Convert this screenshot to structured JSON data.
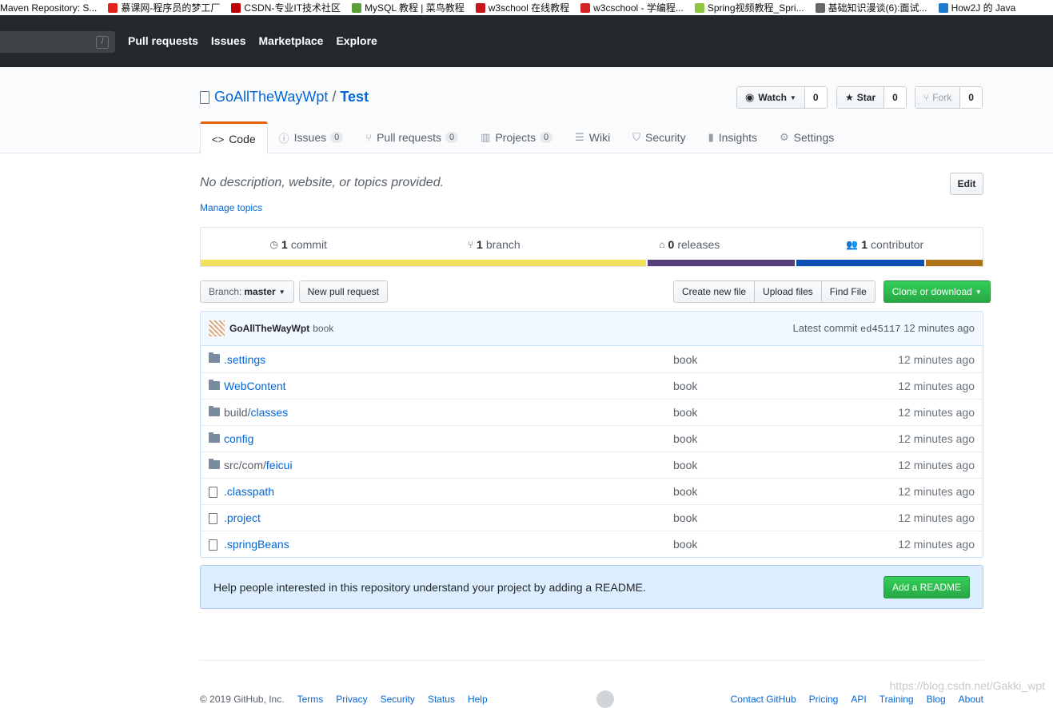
{
  "bookmarks": [
    {
      "label": "Maven Repository: S...",
      "color": "#ffffff"
    },
    {
      "label": "慕课网-程序员的梦工厂",
      "color": "#e2231a"
    },
    {
      "label": "CSDN-专业IT技术社区",
      "color": "#c00000"
    },
    {
      "label": "MySQL 教程 | 菜鸟教程",
      "color": "#5a9f35"
    },
    {
      "label": "w3school 在线教程",
      "color": "#c7161e"
    },
    {
      "label": "w3cschool - 学编程...",
      "color": "#d42322"
    },
    {
      "label": "Spring视频教程_Spri...",
      "color": "#8cc63e"
    },
    {
      "label": "基础知识漫谈(6):面试...",
      "color": "#666666"
    },
    {
      "label": "How2J 的 Java",
      "color": "#1e7bd0"
    }
  ],
  "header": {
    "search_slash": "/",
    "nav": [
      "Pull requests",
      "Issues",
      "Marketplace",
      "Explore"
    ]
  },
  "repo": {
    "owner": "GoAllTheWayWpt",
    "separator": "/",
    "name": "Test",
    "watch_label": "Watch",
    "watch_count": "0",
    "star_label": "Star",
    "star_count": "0",
    "fork_label": "Fork",
    "fork_count": "0"
  },
  "tabs": [
    {
      "label": "Code",
      "icon": "code-icon",
      "glyph": "<>",
      "counter": ""
    },
    {
      "label": "Issues",
      "icon": "issue-icon",
      "glyph": "ⓘ",
      "counter": "0"
    },
    {
      "label": "Pull requests",
      "icon": "pull-request-icon",
      "glyph": "⑂",
      "counter": "0"
    },
    {
      "label": "Projects",
      "icon": "project-icon",
      "glyph": "▥",
      "counter": "0"
    },
    {
      "label": "Wiki",
      "icon": "book-icon",
      "glyph": "☰",
      "counter": ""
    },
    {
      "label": "Security",
      "icon": "shield-icon",
      "glyph": "⛉",
      "counter": ""
    },
    {
      "label": "Insights",
      "icon": "graph-icon",
      "glyph": "▮",
      "counter": ""
    },
    {
      "label": "Settings",
      "icon": "gear-icon",
      "glyph": "⚙",
      "counter": ""
    }
  ],
  "description": {
    "text": "No description, website, or topics provided.",
    "manage_topics": "Manage topics",
    "edit_label": "Edit"
  },
  "summary": [
    {
      "count": "1",
      "label": "commit",
      "icon": "history-icon",
      "glyph": "◷"
    },
    {
      "count": "1",
      "label": "branch",
      "icon": "branch-icon",
      "glyph": "⑂"
    },
    {
      "count": "0",
      "label": "releases",
      "icon": "tag-icon",
      "glyph": "⌂"
    },
    {
      "count": "1",
      "label": "contributor",
      "icon": "people-icon",
      "glyph": "👥"
    }
  ],
  "languages": [
    {
      "color": "#f1e05a",
      "percent": 57.3
    },
    {
      "color": "#563d7c",
      "percent": 18.9
    },
    {
      "color": "#0d4fb3",
      "percent": 16.5
    },
    {
      "color": "#b07219",
      "percent": 7.3
    }
  ],
  "file_nav": {
    "branch_label": "Branch:",
    "branch_value": "master",
    "new_pr": "New pull request",
    "create_file": "Create new file",
    "upload_files": "Upload files",
    "find_file": "Find File",
    "clone": "Clone or download"
  },
  "latest_commit": {
    "author": "GoAllTheWayWpt",
    "message": "book",
    "prefix": "Latest commit",
    "sha": "ed45117",
    "age": "12 minutes ago"
  },
  "files": [
    {
      "type": "dir",
      "prefix": "",
      "name": ".settings",
      "message": "book",
      "age": "12 minutes ago"
    },
    {
      "type": "dir",
      "prefix": "",
      "name": "WebContent",
      "message": "book",
      "age": "12 minutes ago"
    },
    {
      "type": "dir",
      "prefix": "build/",
      "name": "classes",
      "message": "book",
      "age": "12 minutes ago"
    },
    {
      "type": "dir",
      "prefix": "",
      "name": "config",
      "message": "book",
      "age": "12 minutes ago"
    },
    {
      "type": "dir",
      "prefix": "src/com/",
      "name": "feicui",
      "message": "book",
      "age": "12 minutes ago"
    },
    {
      "type": "file",
      "prefix": "",
      "name": ".classpath",
      "message": "book",
      "age": "12 minutes ago"
    },
    {
      "type": "file",
      "prefix": "",
      "name": ".project",
      "message": "book",
      "age": "12 minutes ago"
    },
    {
      "type": "file",
      "prefix": "",
      "name": ".springBeans",
      "message": "book",
      "age": "12 minutes ago"
    }
  ],
  "readme": {
    "text": "Help people interested in this repository understand your project by adding a README.",
    "button": "Add a README"
  },
  "footer": {
    "copyright": "© 2019 GitHub, Inc.",
    "left_links": [
      "Terms",
      "Privacy",
      "Security",
      "Status",
      "Help"
    ],
    "right_links": [
      "Contact GitHub",
      "Pricing",
      "API",
      "Training",
      "Blog",
      "About"
    ]
  },
  "watermark": "https://blog.csdn.net/Gakki_wpt",
  "colors": {
    "header_bg": "#24292e",
    "link": "#0366d6",
    "active_tab_accent": "#e36209",
    "primary_button": "#28a745"
  }
}
